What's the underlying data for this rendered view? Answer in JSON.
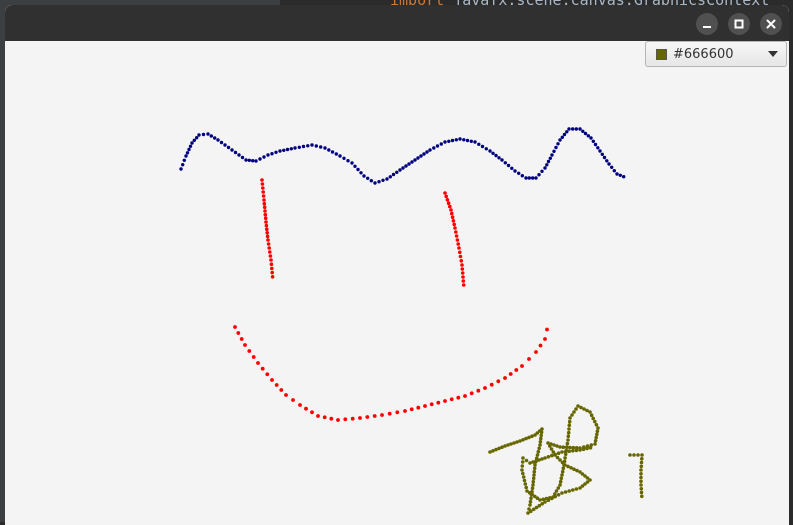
{
  "background_editor": {
    "keyword": "import",
    "code": " javafx.scene.canvas.GraphicsContext"
  },
  "window": {
    "controls": {
      "minimize_icon": "minimize-icon",
      "maximize_icon": "maximize-icon",
      "close_icon": "close-icon"
    }
  },
  "color_picker": {
    "value": "#666600",
    "swatch_color": "#666600",
    "arrow_icon": "chevron-down-icon"
  },
  "colors": {
    "canvas_background": "#f4f4f4",
    "stroke_navy": "#000080",
    "stroke_red": "#ff0000",
    "stroke_olive": "#666600"
  },
  "drawing": {
    "strokes": [
      {
        "name": "wavy-hair-stroke",
        "color": "navy"
      },
      {
        "name": "left-eye-stroke",
        "color": "red"
      },
      {
        "name": "right-eye-stroke",
        "color": "red"
      },
      {
        "name": "smile-stroke",
        "color": "red"
      },
      {
        "name": "scribble-stroke",
        "color": "olive"
      },
      {
        "name": "scribble-edge-stroke",
        "color": "olive"
      }
    ]
  }
}
